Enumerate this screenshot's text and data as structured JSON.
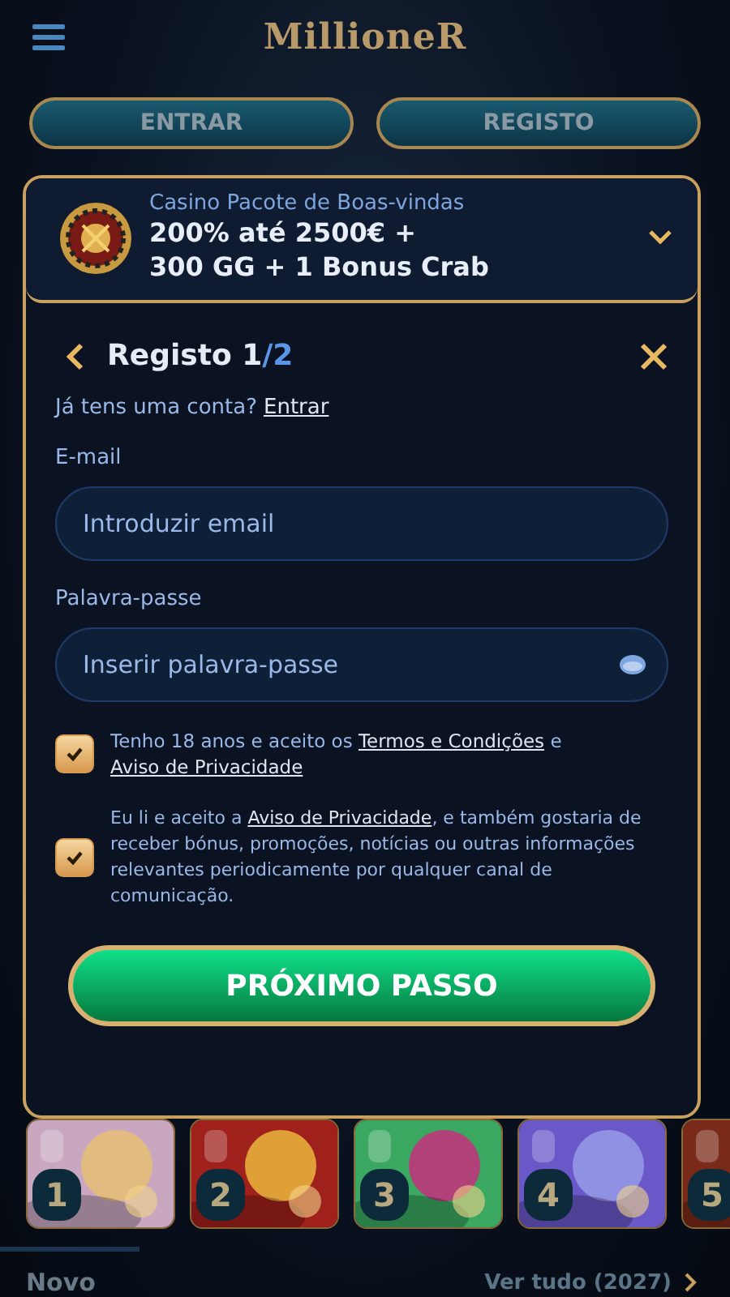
{
  "header": {
    "logo": "MillioneR"
  },
  "auth_buttons": [
    {
      "label": "ENTRAR"
    },
    {
      "label": "REGISTO"
    }
  ],
  "bonus": {
    "caption": "Casino Pacote de Boas-vindas",
    "title_lines": [
      "200% até 2500€ +",
      "300 GG + 1 Bonus Crab"
    ],
    "expanded": false
  },
  "form": {
    "title": "Registo 1",
    "title_total": "/2",
    "account_prompt": "Já tens uma conta?",
    "account_link": "Entrar",
    "fields": [
      {
        "label": "E-mail",
        "placeholder": "Introduzir email",
        "kind": "text"
      },
      {
        "label": "Palavra-passe",
        "placeholder": "Inserir palavra-passe",
        "kind": "password"
      }
    ],
    "consents": [
      {
        "checked": true,
        "parts": [
          {
            "kind": "text",
            "text": "Tenho 18 anos e aceito os "
          },
          {
            "kind": "link",
            "text": "Termos e Condições"
          },
          {
            "kind": "text",
            "text": " e "
          },
          {
            "kind": "link",
            "text": "Aviso de Privacidade"
          }
        ]
      },
      {
        "checked": true,
        "parts": [
          {
            "kind": "text",
            "text": "Eu li e aceito a "
          },
          {
            "kind": "link",
            "text": "Aviso de Privacidade"
          },
          {
            "kind": "text",
            "text": ", e também gostaria de receber bónus, promoções, notícias ou outras informações relevantes periodicamente por qualquer canal de comunicação."
          }
        ]
      }
    ],
    "submit": "PRÓXIMO PASSO"
  },
  "games": [
    {
      "rank": "1",
      "color": "#c9a7c0"
    },
    {
      "rank": "2",
      "color": "#a0201c"
    },
    {
      "rank": "3",
      "color": "#3aa860"
    },
    {
      "rank": "4",
      "color": "#6a58c8"
    },
    {
      "rank": "5",
      "color": "#7a2a18"
    }
  ],
  "section": {
    "title": "Novo",
    "view_all": "Ver tudo (2027)"
  }
}
